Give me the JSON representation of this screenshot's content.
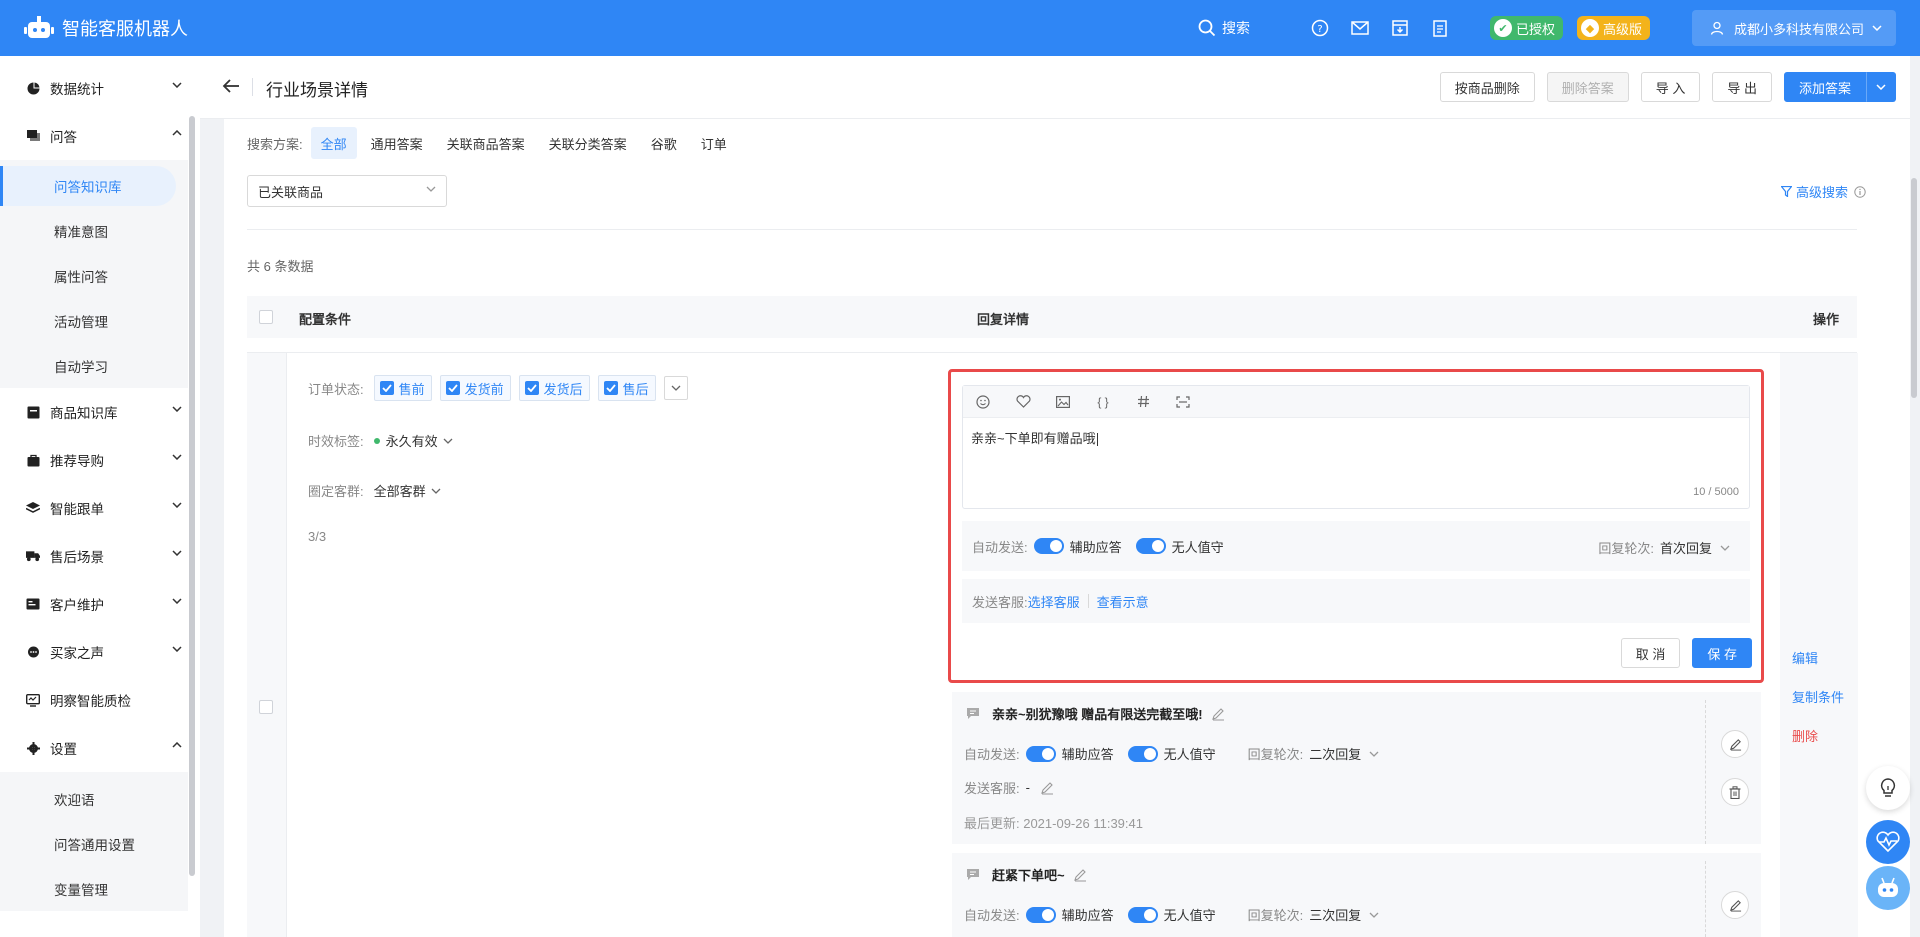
{
  "app": {
    "title": "智能客服机器人"
  },
  "topbar": {
    "search_label": "搜索",
    "authorized": "已授权",
    "edition": "高级版",
    "company": "成都小多科技有限公司"
  },
  "sidebar": {
    "groups": [
      {
        "label": "数据统计"
      },
      {
        "label": "问答"
      },
      {
        "label": "商品知识库"
      },
      {
        "label": "推荐导购"
      },
      {
        "label": "智能跟单"
      },
      {
        "label": "售后场景"
      },
      {
        "label": "客户维护"
      },
      {
        "label": "买家之声"
      },
      {
        "label": "明察智能质检"
      },
      {
        "label": "设置"
      }
    ],
    "qa_items": [
      "问答知识库",
      "精准意图",
      "属性问答",
      "活动管理",
      "自动学习"
    ],
    "settings_items": [
      "欢迎语",
      "问答通用设置",
      "变量管理"
    ]
  },
  "header": {
    "title": "行业场景详情",
    "buttons": {
      "delete_by_product": "按商品删除",
      "delete_answer": "删除答案",
      "import": "导 入",
      "export": "导 出",
      "add_answer": "添加答案"
    }
  },
  "filters": {
    "scheme_label": "搜索方案:",
    "tabs": [
      "全部",
      "通用答案",
      "关联商品答案",
      "关联分类答案",
      "谷歌",
      "订单"
    ],
    "active_tab": "全部",
    "select_value": "已关联商品",
    "advanced_search": "高级搜索"
  },
  "table": {
    "total": "共 6 条数据",
    "col_condition": "配置条件",
    "col_reply": "回复详情",
    "col_ops": "操作"
  },
  "conditions": {
    "order_status_label": "订单状态:",
    "order_status_tags": [
      "售前",
      "发货前",
      "发货后",
      "售后"
    ],
    "validity_label": "时效标签:",
    "validity_value": "永久有效",
    "audience_label": "圈定客群:",
    "audience_value": "全部客群",
    "pager": "3/3"
  },
  "editor": {
    "text": "亲亲~下单即有赠品哦",
    "counter": "10 / 5000",
    "auto_send_label": "自动发送:",
    "assist": "辅助应答",
    "unattended": "无人值守",
    "round_label": "回复轮次:",
    "round_value": "首次回复",
    "send_service_label": "发送客服:",
    "choose_service": "选择客服",
    "view_example": "查看示意",
    "cancel": "取 消",
    "save": "保 存"
  },
  "answers": [
    {
      "text": "亲亲~别犹豫哦 赠品有限送完截至哦!",
      "auto_send_label": "自动发送:",
      "assist": "辅助应答",
      "unattended": "无人值守",
      "round_label": "回复轮次:",
      "round_value": "二次回复",
      "service_label": "发送客服:",
      "service_value": "-",
      "updated": "最后更新: 2021-09-26 11:39:41"
    },
    {
      "text": "赶紧下单吧~",
      "auto_send_label": "自动发送:",
      "assist": "辅助应答",
      "unattended": "无人值守",
      "round_label": "回复轮次:",
      "round_value": "三次回复"
    }
  ],
  "ops": {
    "edit": "编辑",
    "copy": "复制条件",
    "delete": "删除"
  }
}
